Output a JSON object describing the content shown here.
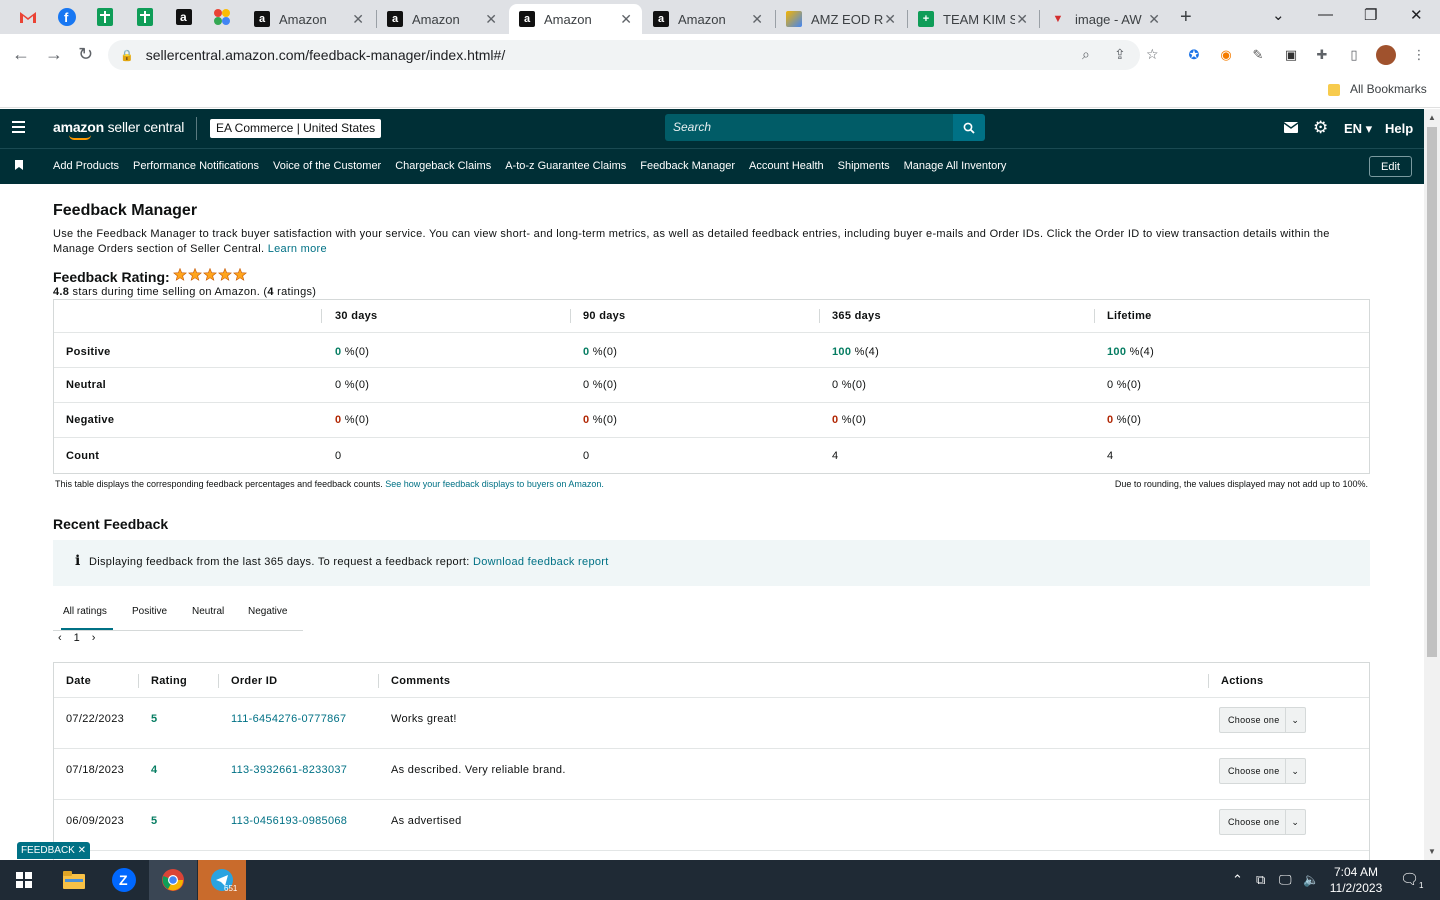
{
  "browser": {
    "tabs": [
      {
        "title": "Amazon",
        "favicon": "amazon-icon"
      },
      {
        "title": "Amazon",
        "favicon": "amazon-icon"
      },
      {
        "title": "Amazon",
        "favicon": "amazon-icon",
        "active": true
      },
      {
        "title": "Amazon",
        "favicon": "amazon-icon"
      },
      {
        "title": "AMZ EOD R",
        "favicon": "sheets-icon"
      },
      {
        "title": "TEAM KIM S",
        "favicon": "sheets-icon"
      },
      {
        "title": "image - AW",
        "favicon": "red-icon"
      }
    ],
    "url": "sellercentral.amazon.com/feedback-manager/index.html#/",
    "bookmarks_label": "All Bookmarks"
  },
  "header": {
    "logo_bold": "amazon",
    "logo_light": " seller central",
    "store": "EA Commerce | United States",
    "search_placeholder": "Search",
    "language": "EN",
    "help": "Help"
  },
  "nav": {
    "items": [
      "Add Products",
      "Performance Notifications",
      "Voice of the Customer",
      "Chargeback Claims",
      "A-to-z Guarantee Claims",
      "Feedback Manager",
      "Account Health",
      "Shipments",
      "Manage All Inventory"
    ],
    "edit": "Edit"
  },
  "page": {
    "title": "Feedback Manager",
    "intro": "Use the Feedback Manager to track buyer satisfaction with your service. You can view short- and long-term metrics, as well as detailed feedback entries, including buyer e-mails and Order IDs. Click the Order ID to view transaction details within the Manage Orders section of Seller Central.",
    "learn_more": "Learn more",
    "rating_title": "Feedback Rating:",
    "rating_stars": 5,
    "rating_value": "4.8",
    "rating_sub_a": " stars during time selling on Amazon. (",
    "rating_count": "4",
    "rating_sub_b": " ratings)"
  },
  "metrics": {
    "columns": [
      "30 days",
      "90 days",
      "365 days",
      "Lifetime"
    ],
    "rows": [
      {
        "label": "Positive",
        "cells": [
          {
            "v": "0",
            "s": " %(0)"
          },
          {
            "v": "0",
            "s": " %(0)"
          },
          {
            "v": "100",
            "s": " %(4)"
          },
          {
            "v": "100",
            "s": " %(4)"
          }
        ]
      },
      {
        "label": "Neutral",
        "cells": [
          {
            "v": "0",
            "s": " %(0)"
          },
          {
            "v": "0",
            "s": " %(0)"
          },
          {
            "v": "0",
            "s": " %(0)"
          },
          {
            "v": "0",
            "s": " %(0)"
          }
        ]
      },
      {
        "label": "Negative",
        "cells": [
          {
            "v": "0",
            "s": " %(0)"
          },
          {
            "v": "0",
            "s": " %(0)"
          },
          {
            "v": "0",
            "s": " %(0)"
          },
          {
            "v": "0",
            "s": " %(0)"
          }
        ]
      },
      {
        "label": "Count",
        "cells": [
          {
            "v": "0",
            "s": ""
          },
          {
            "v": "0",
            "s": ""
          },
          {
            "v": "4",
            "s": ""
          },
          {
            "v": "4",
            "s": ""
          }
        ]
      }
    ],
    "note_left": "This table displays the corresponding feedback percentages and feedback counts.",
    "note_link": "See how your feedback displays to buyers on Amazon.",
    "note_right": "Due to rounding, the values displayed may not add up to 100%."
  },
  "recent": {
    "title": "Recent Feedback",
    "info": "Displaying feedback from the last 365 days. To request a feedback report:",
    "info_link": "Download feedback report",
    "tabs": [
      "All ratings",
      "Positive",
      "Neutral",
      "Negative"
    ],
    "page": "1",
    "columns": [
      "Date",
      "Rating",
      "Order ID",
      "Comments",
      "Actions"
    ],
    "rows": [
      {
        "date": "07/22/2023",
        "rating": "5",
        "order": "111-6454276-0777867",
        "comment": "Works great!",
        "action": "Choose one"
      },
      {
        "date": "07/18/2023",
        "rating": "4",
        "order": "113-3932661-8233037",
        "comment": "As described. Very reliable brand.",
        "action": "Choose one"
      },
      {
        "date": "06/09/2023",
        "rating": "5",
        "order": "113-0456193-0985068",
        "comment": "As advertised",
        "action": "Choose one"
      }
    ]
  },
  "feedback_tab": "FEEDBACK",
  "taskbar": {
    "time": "7:04 AM",
    "date": "11/2/2023",
    "telegram_badge": "651",
    "notif_count": "1"
  },
  "colors": {
    "header_bg": "#002f36",
    "link": "#007185",
    "positive": "#067d62",
    "negative": "#b12704",
    "star": "#ffa41c"
  }
}
